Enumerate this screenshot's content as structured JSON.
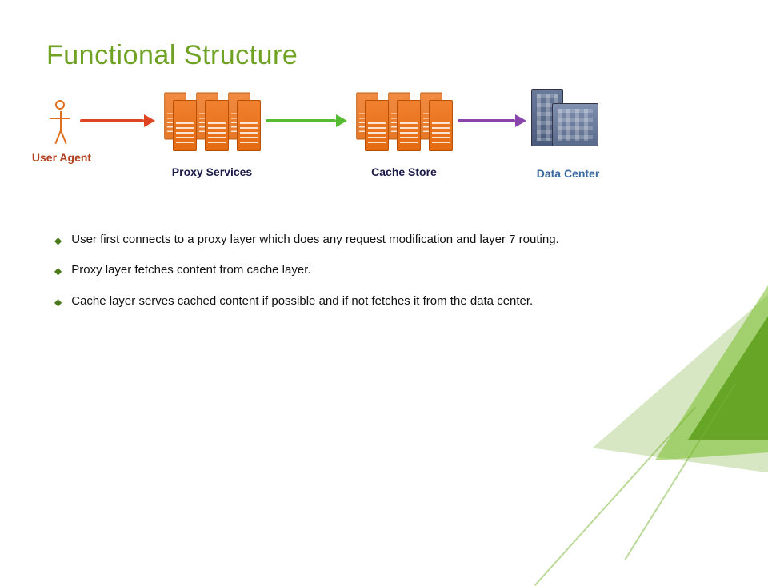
{
  "title": "Functional Structure",
  "diagram": {
    "nodes": {
      "user_agent": "User Agent",
      "proxy": "Proxy Services",
      "cache": "Cache Store",
      "data_center": "Data Center"
    },
    "arrows": [
      {
        "from": "user_agent",
        "to": "proxy",
        "color": "red"
      },
      {
        "from": "proxy",
        "to": "cache",
        "color": "green"
      },
      {
        "from": "cache",
        "to": "data_center",
        "color": "purple"
      }
    ]
  },
  "bullets": [
    "User first connects to a proxy layer which does any request modification and layer 7 routing.",
    "Proxy layer fetches content from cache layer.",
    "Cache layer serves cached content if possible and if not fetches it from the data center."
  ]
}
